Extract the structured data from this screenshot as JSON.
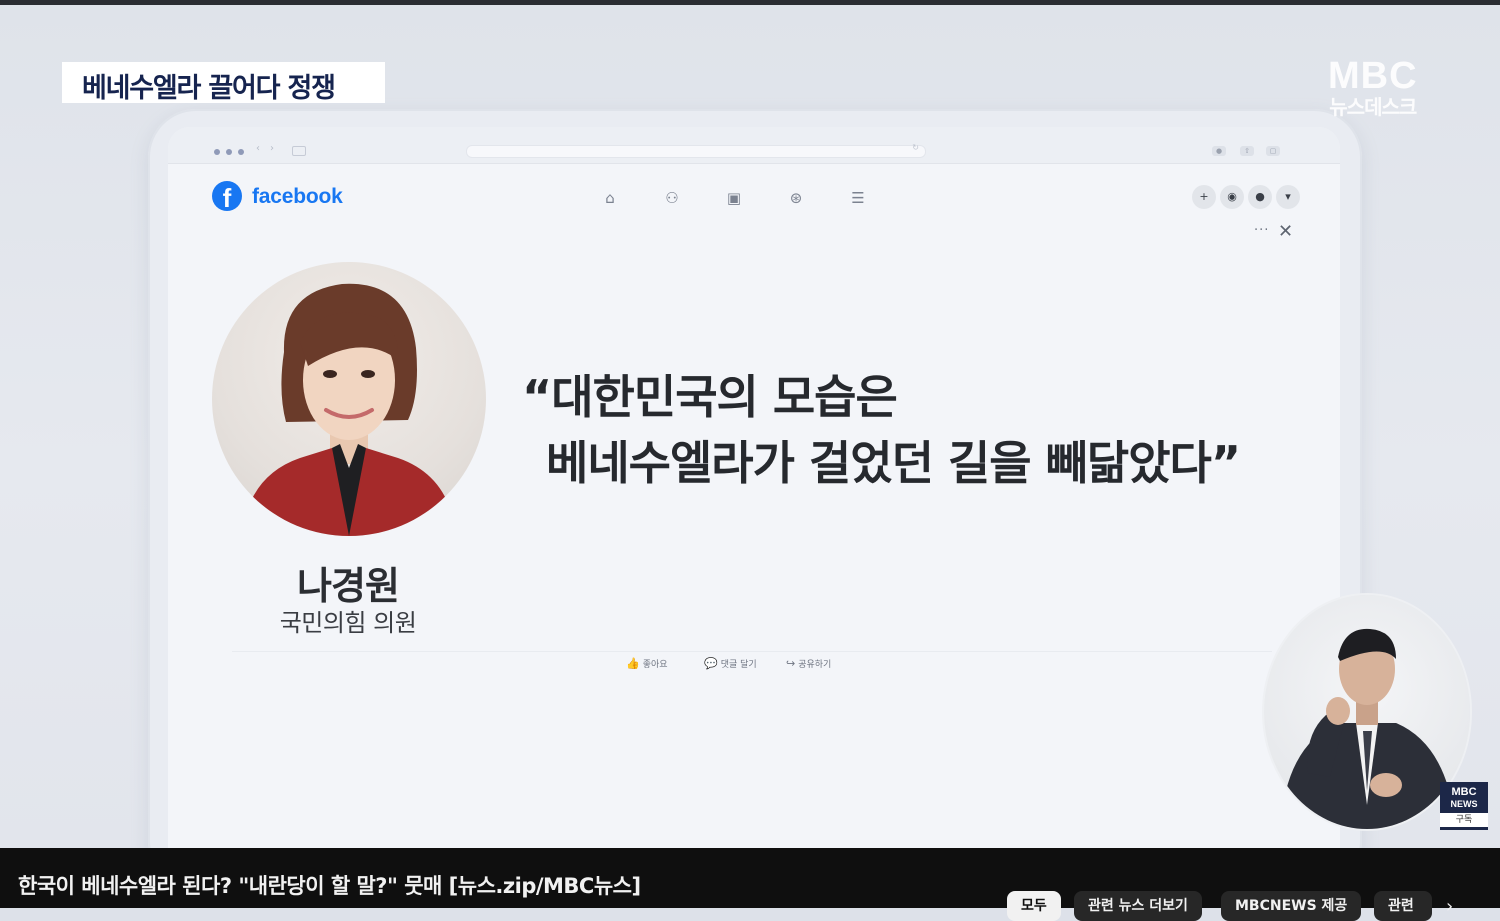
{
  "news": {
    "caption": "베네수엘라 끌어다 정쟁",
    "logo_text": "MBC",
    "logo_sub": "뉴스데스크",
    "quote_line1": "“대한민국의 모습은",
    "quote_line2": "베네수엘라가 걸었던 길을 빼닮았다”",
    "person_name": "나경원",
    "person_role": "국민의힘 의원",
    "badge_line1": "MBC",
    "badge_line2": "NEWS",
    "badge_subscribe": "구독"
  },
  "facebook": {
    "brand": "facebook",
    "logo_glyph": "f",
    "nav_icons": [
      "home-icon",
      "friends-icon",
      "video-icon",
      "groups-icon",
      "menu-icon"
    ],
    "actions": {
      "like": "좋아요",
      "comment": "댓글 달기",
      "share": "공유하기"
    },
    "more_glyph": "···",
    "close_glyph": "✕"
  },
  "player": {
    "title": "한국이 베네수엘라 된다? \"내란당이 할 말?\" 뭇매 [뉴스.zip/MBC뉴스]",
    "chips": [
      "모두",
      "관련 뉴스 더보기",
      "MBCNEWS 제공",
      "관련"
    ],
    "active_chip": "모두"
  },
  "colors": {
    "facebook_blue": "#1877f2",
    "caption_text": "#16244f",
    "player_bar": "#0f0f0f"
  }
}
